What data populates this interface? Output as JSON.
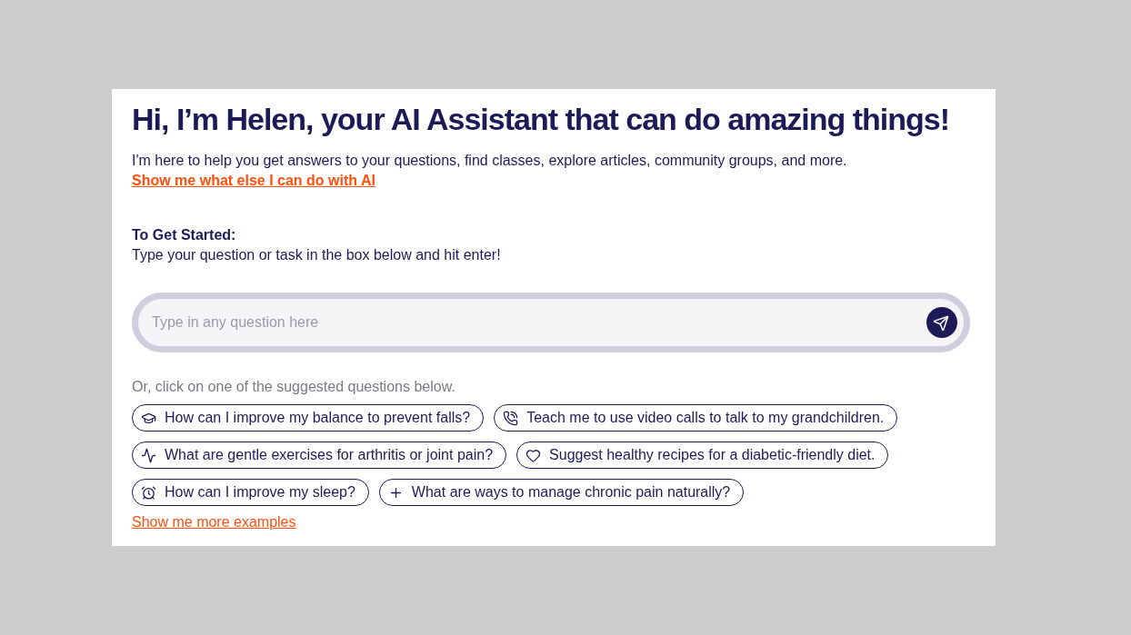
{
  "heading": "Hi, I’m Helen, your AI Assistant that can do amazing things!",
  "intro": "I'm here to help you get answers to your questions, find classes, explore articles, community groups, and more.",
  "capabilities_link": "Show me what else I can do with AI",
  "getting_started": {
    "title": "To Get Started:",
    "text": "Type your question or task in the box below and hit enter!"
  },
  "question_field": {
    "placeholder": "Type in any question here"
  },
  "suggestions_hint": "Or, click on one of the suggested questions below.",
  "suggestions": [
    "How can I improve my balance to prevent falls?",
    "Teach me to use video calls to talk to my grandchildren.",
    "What are gentle exercises for arthritis or joint pain?",
    "Suggest healthy recipes for a diabetic-friendly diet.",
    "How can I improve my sleep?",
    "What are ways to manage chronic pain naturally?"
  ],
  "more_link": "Show me more examples"
}
